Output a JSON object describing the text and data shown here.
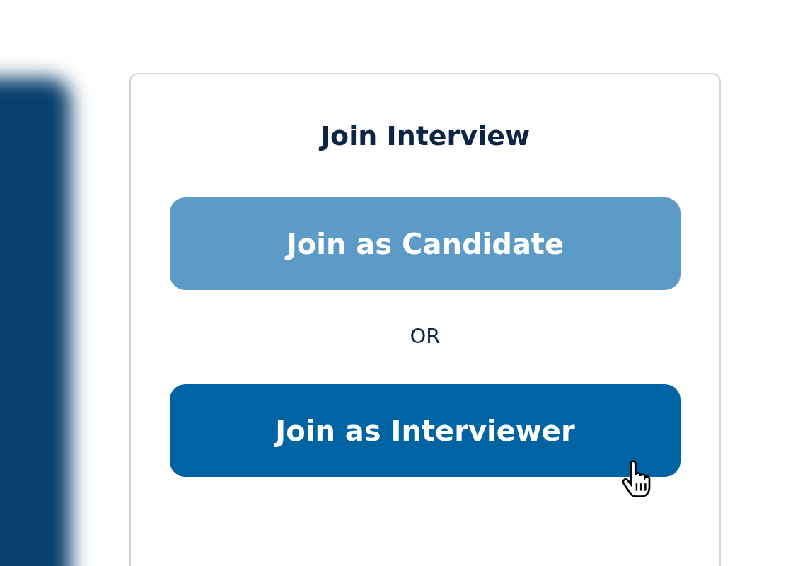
{
  "card": {
    "title": "Join Interview",
    "buttons": [
      {
        "label": "Join as Candidate",
        "hovered": false
      },
      {
        "label": "Join as Interviewer",
        "hovered": true
      }
    ],
    "separator": "OR"
  }
}
